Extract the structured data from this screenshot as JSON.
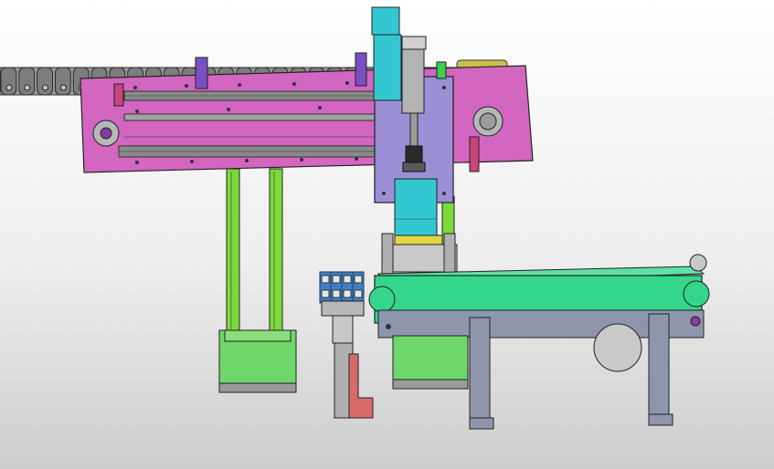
{
  "scene": {
    "kind": "cad-assembly-render",
    "background": {
      "top": "#ffffff",
      "bottom": "#cdcdcd"
    },
    "colors": {
      "gantry_plate": "#d266c0",
      "carriage_plate": "#9b8fd6",
      "cylinder_block": "#33c7d1",
      "support_rod": "#7cd93a",
      "base_block": "#6fd66a",
      "conveyor_belt": "#33d68a",
      "conveyor_frame": "#8f95ad",
      "gripper_finger": "#d96a6a",
      "gripper_pad": "#e3d545",
      "terminal_block": "#3f7fc4",
      "cable_chain": "#7d7d7d",
      "rail": "#8a8a8a",
      "sensor": "#3bd04d"
    },
    "parts": {
      "cable_chain_links": 28,
      "support_rods": 2,
      "terminal_cells": 4
    }
  }
}
